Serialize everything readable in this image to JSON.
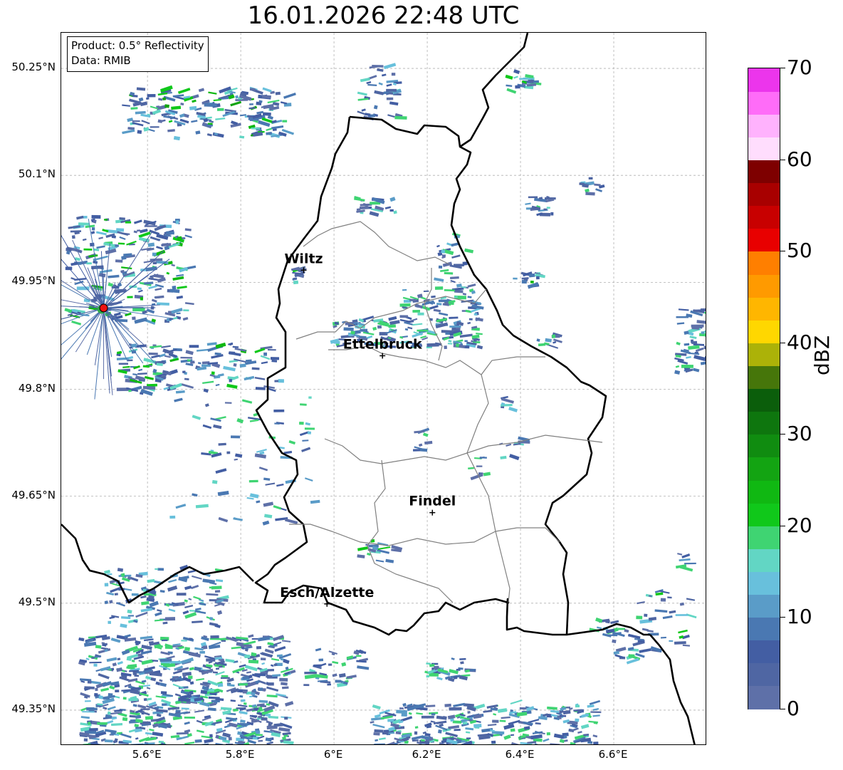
{
  "title": "16.01.2026 22:48 UTC",
  "info_box": {
    "line1": "Product: 0.5° Reflectivity",
    "line2": "Data: RMIB"
  },
  "map": {
    "lon_range": [
      5.415,
      6.8
    ],
    "lat_range": [
      49.3,
      50.3
    ],
    "lat_ticks": [
      "50.25°N",
      "50.1°N",
      "49.95°N",
      "49.8°N",
      "49.65°N",
      "49.5°N",
      "49.35°N"
    ],
    "lon_ticks": [
      "5.6°E",
      "5.8°E",
      "6°E",
      "6.2°E",
      "6.4°E",
      "6.6°E"
    ],
    "gridlines": true,
    "border_color": "#000000",
    "canton_color": "#808080",
    "cities": [
      {
        "name": "Wiltz",
        "lon": 5.935,
        "lat": 49.967
      },
      {
        "name": "Ettelbruck",
        "lon": 6.104,
        "lat": 49.847
      },
      {
        "name": "Findel",
        "lon": 6.211,
        "lat": 49.627
      },
      {
        "name": "Esch/Alzette",
        "lon": 5.985,
        "lat": 49.499
      }
    ],
    "radar_site": {
      "lon": 5.506,
      "lat": 49.914,
      "color": "#ee1111"
    }
  },
  "colorbar": {
    "label": "dBZ",
    "min": 0,
    "max": 70,
    "tick_labels": [
      "0",
      "10",
      "20",
      "30",
      "40",
      "50",
      "60",
      "70"
    ],
    "colors": [
      "#5e70a8",
      "#4f66a3",
      "#435ea3",
      "#4a78b2",
      "#5a9cc8",
      "#68c0dc",
      "#62d6c4",
      "#3fd472",
      "#10c81a",
      "#10b812",
      "#13a412",
      "#108c10",
      "#0e760e",
      "#0b5e0b",
      "#46760a",
      "#acb208",
      "#ffd700",
      "#ffb600",
      "#ff9a00",
      "#ff7f00",
      "#e80000",
      "#c80000",
      "#a80000",
      "#7e0000",
      "#ffddfd",
      "#ffb2fd",
      "#ff6cf8",
      "#ec35ec"
    ]
  }
}
